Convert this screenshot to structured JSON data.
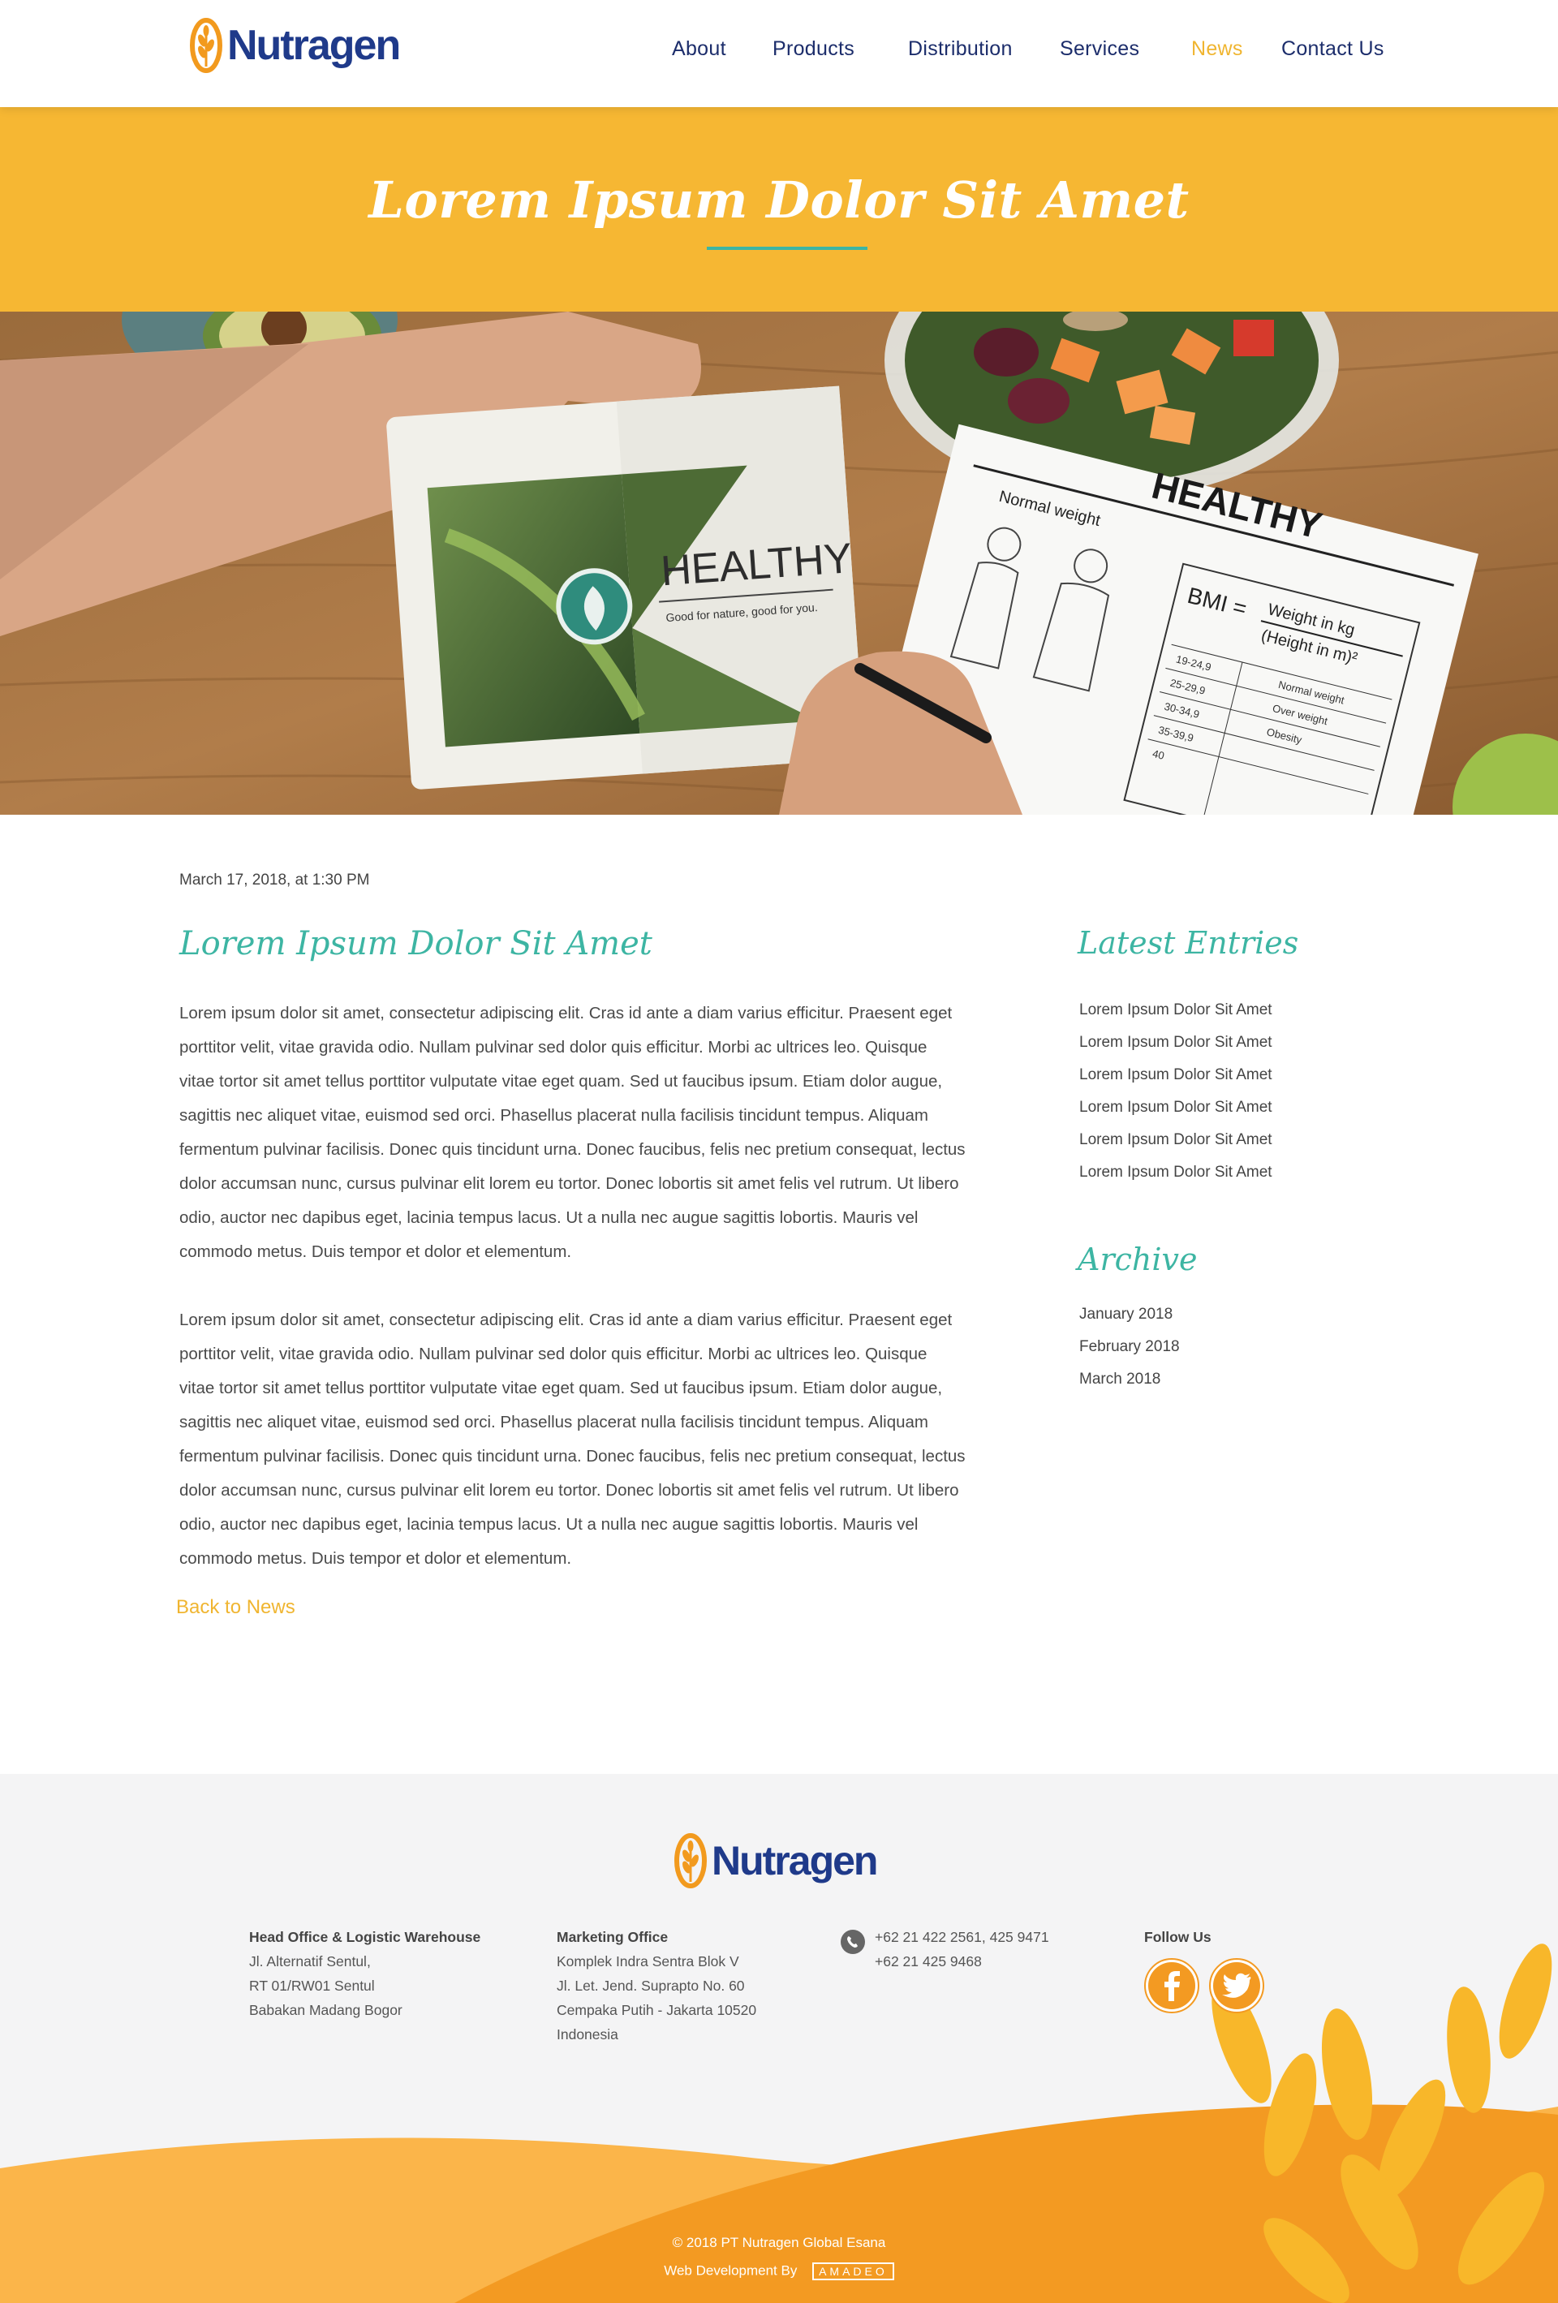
{
  "brand": {
    "name": "Nutragen",
    "accent": "#f6b733",
    "teal": "#3db5a3",
    "navy": "#1f3a8a"
  },
  "nav": {
    "items": [
      {
        "label": "About"
      },
      {
        "label": "Products"
      },
      {
        "label": "Distribution"
      },
      {
        "label": "Services"
      },
      {
        "label": "News"
      },
      {
        "label": "Contact Us"
      }
    ],
    "active": "News"
  },
  "banner": {
    "title": "Lorem Ipsum Dolor Sit Amet"
  },
  "hero": {
    "notebook_heading": "HEALTHY",
    "notebook_tagline": "Good for nature, good for you.",
    "sheet_heading": "HEALTHY",
    "sheet_subtitle": "Normal weight",
    "bmi_label": "BMI =",
    "bmi_formula_top": "Weight in kg",
    "bmi_formula_bottom": "(Height in m)²",
    "bmi_rows": [
      {
        "range": "19-24,9",
        "label": "Normal weight"
      },
      {
        "range": "25-29,9",
        "label": "Over weight"
      },
      {
        "range": "30-34,9",
        "label": "Obesity"
      },
      {
        "range": "35-39,9",
        "label": ""
      },
      {
        "range": "40",
        "label": ""
      }
    ]
  },
  "post": {
    "date": "March 17, 2018, at 1:30 PM",
    "title": "Lorem Ipsum Dolor Sit Amet",
    "paragraphs": [
      "Lorem ipsum dolor sit amet, consectetur adipiscing elit. Cras id ante a diam varius efficitur. Praesent eget porttitor velit, vitae gravida odio. Nullam pulvinar sed dolor quis efficitur. Morbi ac ultrices leo. Quisque vitae tortor sit amet tellus porttitor vulputate vitae eget quam. Sed ut faucibus ipsum. Etiam dolor augue, sagittis nec aliquet vitae, euismod sed orci. Phasellus placerat nulla facilisis tincidunt tempus. Aliquam fermentum pulvinar facilisis. Donec quis tincidunt urna. Donec faucibus, felis nec pretium consequat, lectus dolor accumsan nunc, cursus pulvinar elit lorem eu tortor. Donec lobortis sit amet felis vel rutrum. Ut libero odio, auctor nec dapibus eget, lacinia tempus lacus. Ut a nulla nec augue sagittis lobortis. Mauris vel commodo metus. Duis tempor et dolor et elementum.",
      "Lorem ipsum dolor sit amet, consectetur adipiscing elit. Cras id ante a diam varius efficitur. Praesent eget porttitor velit, vitae gravida odio. Nullam pulvinar sed dolor quis efficitur. Morbi ac ultrices leo. Quisque vitae tortor sit amet tellus porttitor vulputate vitae eget quam. Sed ut faucibus ipsum. Etiam dolor augue, sagittis nec aliquet vitae, euismod sed orci. Phasellus placerat nulla facilisis tincidunt tempus. Aliquam fermentum pulvinar facilisis. Donec quis tincidunt urna. Donec faucibus, felis nec pretium consequat, lectus dolor accumsan nunc, cursus pulvinar elit lorem eu tortor. Donec lobortis sit amet felis vel rutrum. Ut libero odio, auctor nec dapibus eget, lacinia tempus lacus. Ut a nulla nec augue sagittis lobortis. Mauris vel commodo metus. Duis tempor et dolor et elementum."
    ],
    "back_label": "Back to News"
  },
  "sidebar": {
    "latest_heading": "Latest Entries",
    "latest": [
      "Lorem Ipsum Dolor Sit Amet",
      "Lorem Ipsum Dolor Sit Amet",
      "Lorem Ipsum Dolor Sit Amet",
      "Lorem Ipsum Dolor Sit Amet",
      "Lorem Ipsum Dolor Sit Amet",
      "Lorem Ipsum Dolor Sit Amet"
    ],
    "archive_heading": "Archive",
    "archive": [
      "January 2018",
      "February 2018",
      "March 2018"
    ]
  },
  "footer": {
    "head_office": {
      "title": "Head Office & Logistic Warehouse",
      "lines": [
        "Jl. Alternatif Sentul,",
        "RT 01/RW01 Sentul",
        "Babakan Madang Bogor"
      ]
    },
    "marketing_office": {
      "title": "Marketing Office",
      "lines": [
        "Komplek Indra Sentra Blok V",
        "Jl. Let. Jend. Suprapto No. 60",
        "Cempaka Putih - Jakarta 10520",
        "Indonesia"
      ]
    },
    "phones": [
      "+62 21 422 2561, 425 9471",
      "+62 21 425 9468"
    ],
    "follow_title": "Follow Us",
    "social_icons": [
      "facebook-icon",
      "twitter-icon"
    ],
    "copyright": "2018 PT Nutragen Global Esana",
    "credit_label": "Web Development By",
    "credit_logo": "AMADEO"
  }
}
